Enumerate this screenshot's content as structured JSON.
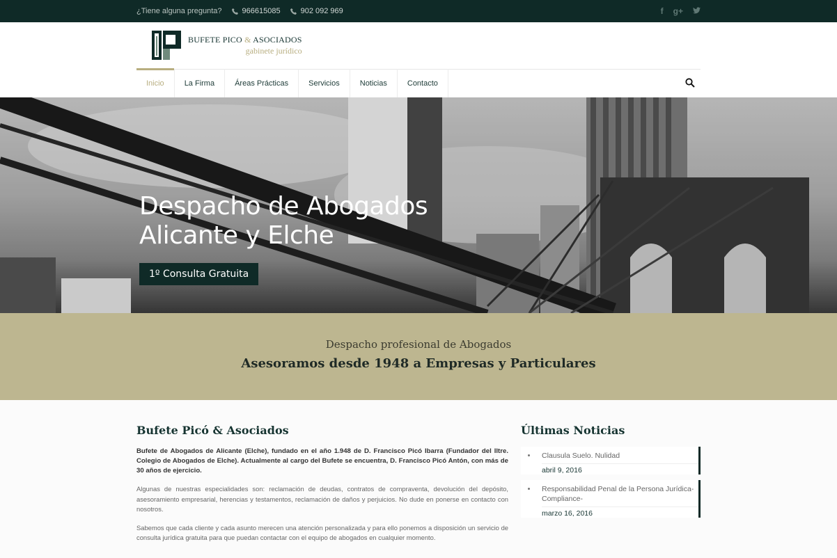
{
  "topbar": {
    "question": "¿Tiene alguna pregunta?",
    "phone1": "966615085",
    "phone2": "902 092 969",
    "social": [
      "facebook-icon",
      "google-plus-icon",
      "twitter-icon"
    ]
  },
  "logo": {
    "line1": "BUFETE PICO",
    "amp": "&",
    "line1b": "ASOCIADOS",
    "line2": "gabinete jurídico"
  },
  "nav": {
    "items": [
      {
        "label": "Inicio",
        "active": true
      },
      {
        "label": "La Firma"
      },
      {
        "label": "Áreas Prácticas"
      },
      {
        "label": "Servicios"
      },
      {
        "label": "Noticias"
      },
      {
        "label": "Contacto"
      }
    ]
  },
  "hero": {
    "title_line1": "Despacho de Abogados",
    "title_line2": "Alicante y Elche",
    "button": "1º Consulta Gratuita"
  },
  "band": {
    "subtitle": "Despacho profesional de Abogados",
    "title": "Asesoramos desde 1948 a Empresas y Particulares"
  },
  "main": {
    "heading": "Bufete Picó & Asociados",
    "lead": "Bufete de Abogados de Alicante (Elche), fundado en el año 1.948 de D. Francisco Picó Ibarra (Fundador del Iltre. Colegio de Abogados de Elche). Actualmente al cargo del Bufete se encuentra, D. Francisco Picó Antón, con más de 30 años de ejercicio.",
    "para1": "Algunas de nuestras especialidades son: reclamación de deudas, contratos de compraventa, devolución del depósito, asesoramiento empresarial, herencias y testamentos, reclamación de daños y perjuicios. No dude en ponerse en contacto con nosotros.",
    "para2": "Sabemos que cada cliente y cada asunto merecen una atención personalizada y para ello ponemos a disposición un servicio de consulta jurídica gratuita para que puedan contactar con el equipo de abogados en cualquier momento."
  },
  "sidebar": {
    "heading": "Últimas Noticias",
    "news": [
      {
        "title": "Clausula Suelo. Nulidad",
        "date": "abril 9, 2016"
      },
      {
        "title": "Responsabilidad Penal de la Persona Jurídica-Compliance-",
        "date": "marzo 16, 2016"
      }
    ]
  },
  "colors": {
    "dark": "#0f2a27",
    "gold": "#b8ae80",
    "band": "#bdb690"
  }
}
